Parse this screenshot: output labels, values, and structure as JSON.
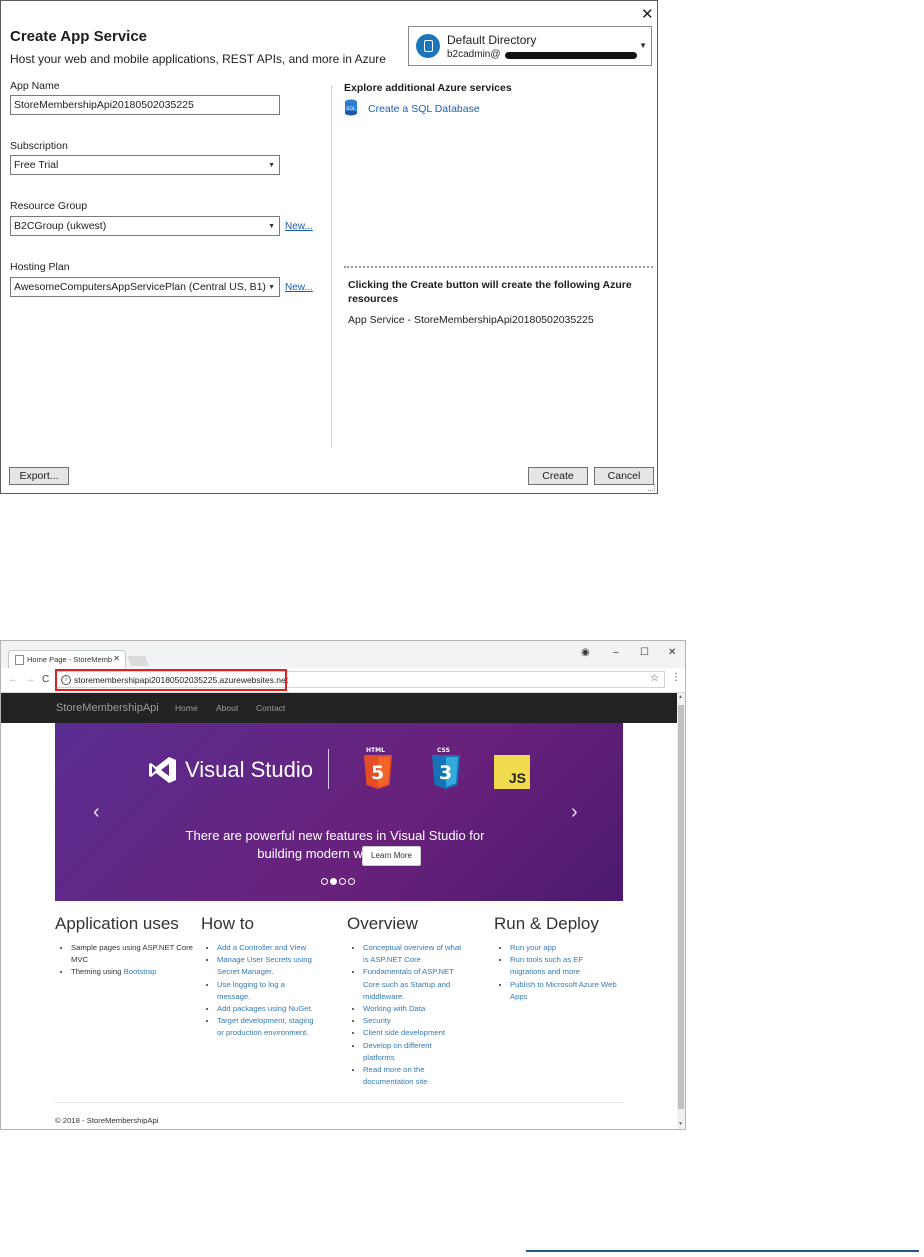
{
  "dialog": {
    "close_glyph": "✕",
    "title": "Create App Service",
    "subtitle": "Host your web and mobile applications, REST APIs, and more in Azure",
    "account": {
      "directory": "Default Directory",
      "email": "b2cadmin@"
    },
    "fields": {
      "app_name_label": "App Name",
      "app_name_value": "StoreMembershipApi20180502035225",
      "subscription_label": "Subscription",
      "subscription_value": "Free Trial",
      "resource_group_label": "Resource Group",
      "resource_group_value": "B2CGroup (ukwest)",
      "hosting_plan_label": "Hosting Plan",
      "hosting_plan_value": "AwesomeComputersAppServicePlan (Central US, B1)",
      "new_link": "New..."
    },
    "explore": {
      "heading": "Explore additional Azure services",
      "sql_link": "Create a SQL Database"
    },
    "summary": {
      "heading": "Clicking the Create button will create the following Azure resources",
      "item": "App Service - StoreMembershipApi20180502035225"
    },
    "buttons": {
      "export": "Export...",
      "create": "Create",
      "cancel": "Cancel"
    }
  },
  "browser": {
    "tab_title": "Home Page - StoreMemb",
    "url": "storemembershipapi20180502035225.azurewebsites.net",
    "site": {
      "brand": "StoreMembershipApi",
      "nav": [
        "Home",
        "About",
        "Contact"
      ],
      "carousel": {
        "logo_text": "Visual Studio",
        "html_label": "HTML",
        "css_label": "CSS",
        "js_label": "JS",
        "caption": "There are powerful new features in Visual Studio for building modern web apps.",
        "button": "Learn More"
      },
      "columns": [
        {
          "heading": "Application uses",
          "items": [
            {
              "text": "Sample pages using ASP.NET Core MVC",
              "link": ""
            },
            {
              "text": "Theming using ",
              "link": "Bootstrap"
            }
          ]
        },
        {
          "heading": "How to",
          "items": [
            {
              "text": "",
              "link": "Add a Controller and View"
            },
            {
              "text": "",
              "link": "Manage User Secrets using Secret Manager."
            },
            {
              "text": "",
              "link": "Use logging to log a message."
            },
            {
              "text": "",
              "link": "Add packages using NuGet."
            },
            {
              "text": "",
              "link": "Target development, staging or production environment."
            }
          ]
        },
        {
          "heading": "Overview",
          "items": [
            {
              "text": "",
              "link": "Conceptual overview of what is ASP.NET Core"
            },
            {
              "text": "",
              "link": "Fundamentals of ASP.NET Core such as Startup and middleware."
            },
            {
              "text": "",
              "link": "Working with Data"
            },
            {
              "text": "",
              "link": "Security"
            },
            {
              "text": "",
              "link": "Client side development"
            },
            {
              "text": "",
              "link": "Develop on different platforms"
            },
            {
              "text": "",
              "link": "Read more on the documentation site"
            }
          ]
        },
        {
          "heading": "Run & Deploy",
          "items": [
            {
              "text": "",
              "link": "Run your app"
            },
            {
              "text": "",
              "link": "Run tools such as EF migrations and more"
            },
            {
              "text": "",
              "link": "Publish to Microsoft Azure Web Apps"
            }
          ]
        }
      ],
      "footer": "© 2018 - StoreMembershipApi"
    }
  },
  "colors": {
    "highlight": "#e02020",
    "link": "#1a5fb4",
    "carousel": "#68217a",
    "navbar": "#222222"
  }
}
